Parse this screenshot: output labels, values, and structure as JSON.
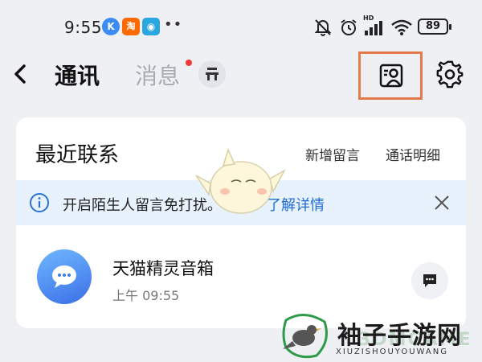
{
  "status_bar": {
    "time": "9:55",
    "apps": [
      {
        "name": "k-app-icon",
        "glyph": "K"
      },
      {
        "name": "taobao-app-icon",
        "glyph": "淘"
      },
      {
        "name": "bilibili-app-icon",
        "glyph": "◉"
      }
    ],
    "more": "••",
    "battery": "89",
    "hd_label": "HD"
  },
  "header": {
    "tab_contacts": "通讯",
    "tab_messages": "消息",
    "has_unread_dot": true
  },
  "recent": {
    "title": "最近联系",
    "new_message_link": "新增留言",
    "call_detail_link": "通话明细"
  },
  "notice": {
    "text": "开启陌生人留言免打扰。",
    "link": "了解详情"
  },
  "contacts": [
    {
      "name": "天猫精灵音箱",
      "time": "上午 09:55"
    }
  ],
  "watermark": {
    "brand": "袖子手游网",
    "pinyin": "XIUZISHOUYOUWANG",
    "overlay": "3DMGAME"
  },
  "colors": {
    "accent_blue": "#1e6bd6",
    "highlight_box": "#e27a4c",
    "notice_bg": "#e8f2fc",
    "unread_dot": "#f23a3a"
  }
}
